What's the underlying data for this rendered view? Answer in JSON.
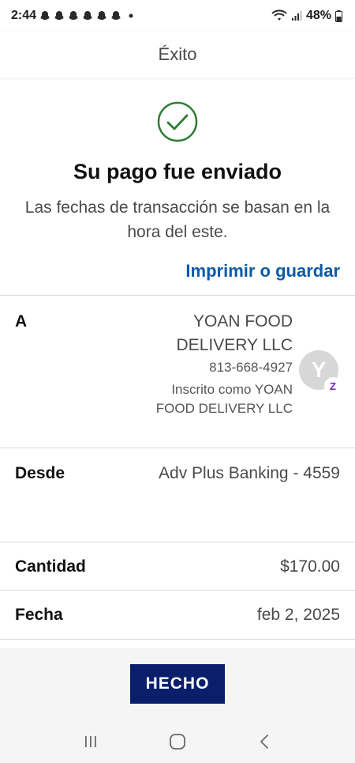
{
  "status_bar": {
    "time": "2:44",
    "battery": "48%",
    "icons": [
      "snapchat-icon",
      "snapchat-icon",
      "snapchat-icon",
      "snapchat-icon",
      "snapchat-icon",
      "snapchat-icon",
      "wifi-icon",
      "signal-icon",
      "battery-icon"
    ]
  },
  "header": {
    "title": "Éxito"
  },
  "confirmation": {
    "icon": "checkmark-circle-icon",
    "title": "Su pago fue enviado",
    "subtitle": "Las fechas de transacción se basan en la hora del este.",
    "print_link": "Imprimir o guardar"
  },
  "details": {
    "to": {
      "label": "A",
      "name": "YOAN FOOD DELIVERY LLC",
      "phone": "813-668-4927",
      "enrolled_as": "Inscrito como YOAN FOOD DELIVERY LLC",
      "avatar_letter": "Y",
      "badge": "Z"
    },
    "from": {
      "label": "Desde",
      "value": "Adv Plus Banking - 4559"
    },
    "amount": {
      "label": "Cantidad",
      "value": "$170.00"
    },
    "date": {
      "label": "Fecha",
      "value": "feb 2, 2025"
    }
  },
  "footer": {
    "done_label": "HECHO"
  },
  "nav": {
    "icons": [
      "recent-apps-icon",
      "home-icon",
      "back-icon"
    ]
  },
  "colors": {
    "accent": "#0a5aa8",
    "success": "#2e7d32",
    "button": "#0a1f6b"
  }
}
